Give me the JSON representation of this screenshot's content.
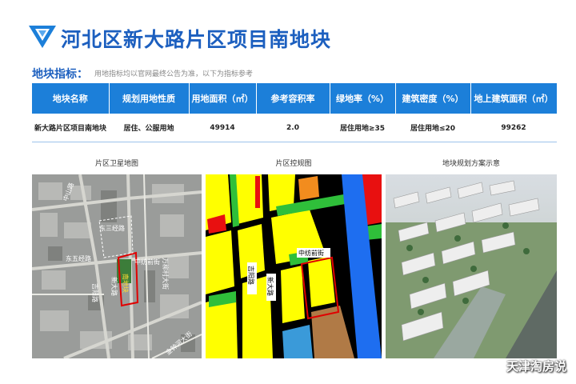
{
  "header": {
    "title": "河北区新大路片区项目南地块"
  },
  "indicators": {
    "title": "地块指标：",
    "note": "用地指标均以官网最终公告为准，以下为指标参考"
  },
  "table": {
    "headers": [
      "地块名称",
      "规划用地性质",
      "用地面积（㎡）",
      "参考容积率",
      "绿地率（%）",
      "建筑密度（%）",
      "地上建筑面积（㎡）"
    ],
    "row": [
      "新大路片区项目南地块",
      "居住、公服用地",
      "49914",
      "2.0",
      "居住用地≥35",
      "居住用地≤20",
      "99262"
    ]
  },
  "captions": {
    "satellite": "片区卫星地图",
    "control": "片区控规图",
    "rendering": "地块规划方案示意"
  },
  "map_labels": {
    "zhongshan": "中山路",
    "dongsan": "东三经路",
    "dongwu": "东五经路",
    "xindalu": "新大路",
    "zhongfang": "中纺前街",
    "wanliu": "万柳村大街",
    "jinhe": "金钟河大街",
    "site": "南地块",
    "jiyang": "吉阳路"
  },
  "control_labels": {
    "zhongfang": "中纺前街",
    "jiyang": "吉阳路",
    "xindalu": "新大路"
  },
  "watermark": "天津淘房说",
  "colors": {
    "brand_blue": "#1c5fbf",
    "header_blue": "#1c7fd9",
    "residential_yellow": "#ffff00",
    "green": "#2fbf3a",
    "blue_water": "#1e6ef0"
  }
}
